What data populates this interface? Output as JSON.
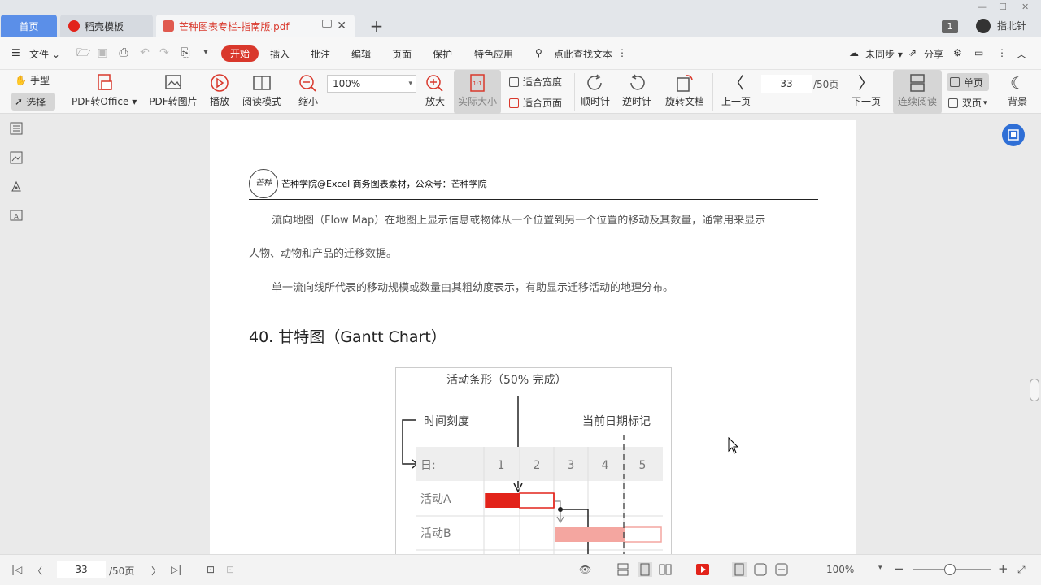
{
  "tabs": {
    "home": "首页",
    "template": "稻壳模板",
    "document": "芒种图表专栏-指南版.pdf",
    "add": "+"
  },
  "window": {
    "badge": "1",
    "user": "指北针"
  },
  "menu": {
    "file": "文件",
    "start": "开始",
    "insert": "插入",
    "annotate": "批注",
    "edit": "编辑",
    "page": "页面",
    "protect": "保护",
    "special": "特色应用",
    "search": "点此查找文本",
    "sync": "未同步",
    "share": "分享"
  },
  "ribbon": {
    "hand": "手型",
    "select": "选择",
    "pdf_to_office": "PDF转Office",
    "pdf_to_image": "PDF转图片",
    "play": "播放",
    "read_mode": "阅读模式",
    "zoom_out": "缩小",
    "zoom_value": "100%",
    "zoom_in": "放大",
    "actual_size": "实际大小",
    "fit_width": "适合宽度",
    "fit_page": "适合页面",
    "rotate_cw": "顺时针",
    "rotate_ccw": "逆时针",
    "rotate_doc": "旋转文档",
    "prev_page": "上一页",
    "page_num": "33",
    "page_total": "/50页",
    "next_page": "下一页",
    "continuous": "连续阅读",
    "single": "单页",
    "double": "双页",
    "background": "背景"
  },
  "document": {
    "header_logo": "芒种",
    "header_text": "芒种学院@Excel 商务图表素材，公众号：芒种学院",
    "para1_line1": "流向地图（Flow Map）在地图上显示信息或物体从一个位置到另一个位置的移动及其数量，通常用来显示",
    "para1_line2": "人物、动物和产品的迁移数据。",
    "para2": "单一流向线所代表的移动规模或数量由其粗幼度表示，有助显示迁移活动的地理分布。",
    "section_title": "40. 甘特图（Gantt Chart）"
  },
  "figure": {
    "label_bar": "活动条形（50% 完成）",
    "label_scale": "时间刻度",
    "label_today": "当前日期标记",
    "day_label": "日:",
    "days": [
      "1",
      "2",
      "3",
      "4",
      "5"
    ],
    "activities": [
      "活动A",
      "活动B"
    ],
    "colors": {
      "bar_strong": "#e2231a",
      "bar_light": "#f4a6a0",
      "grid": "#eeeeee"
    }
  },
  "statusbar": {
    "page_num": "33",
    "page_total": "/50页",
    "zoom": "100%"
  }
}
